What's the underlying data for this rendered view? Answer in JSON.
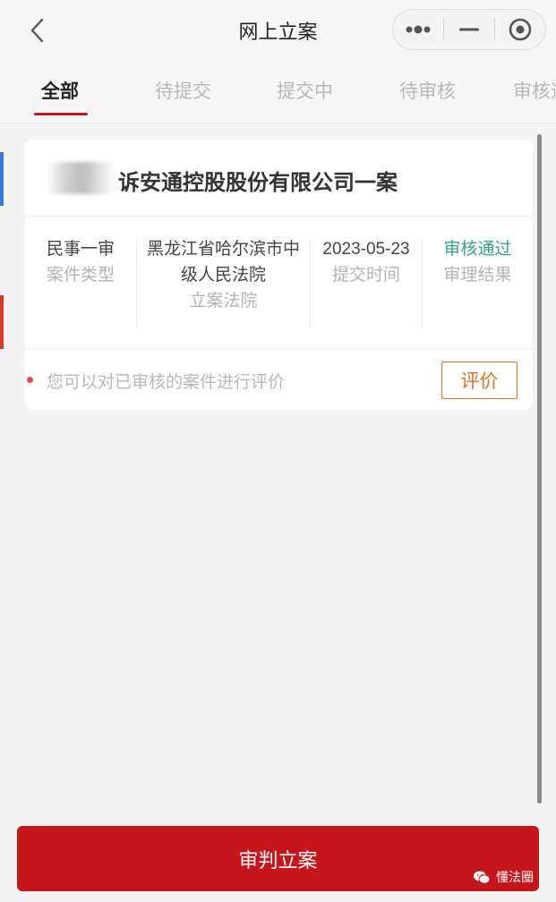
{
  "nav": {
    "title": "网上立案"
  },
  "tabs": [
    {
      "label": "全部",
      "active": true
    },
    {
      "label": "待提交",
      "active": false
    },
    {
      "label": "提交中",
      "active": false
    },
    {
      "label": "待审核",
      "active": false
    },
    {
      "label": "审核通过",
      "active": false
    }
  ],
  "case": {
    "title": "诉安通控股股份有限公司一案",
    "type_value": "民事一审",
    "type_label": "案件类型",
    "court_value_line1": "黑龙江省哈尔滨市中",
    "court_value_line2": "级人民法院",
    "court_label": "立案法院",
    "date_value": "2023-05-23",
    "date_label": "提交时间",
    "result_value": "审核通过",
    "result_label": "审理结果",
    "rate_hint": "您可以对已审核的案件进行评价",
    "rate_button": "评价"
  },
  "bottom": {
    "button_label": "审判立案"
  },
  "watermark": {
    "text": "懂法圈"
  },
  "colors": {
    "accent_red": "#c5161c",
    "pass_green": "#3aa28c",
    "rate_orange": "#d9762b"
  }
}
